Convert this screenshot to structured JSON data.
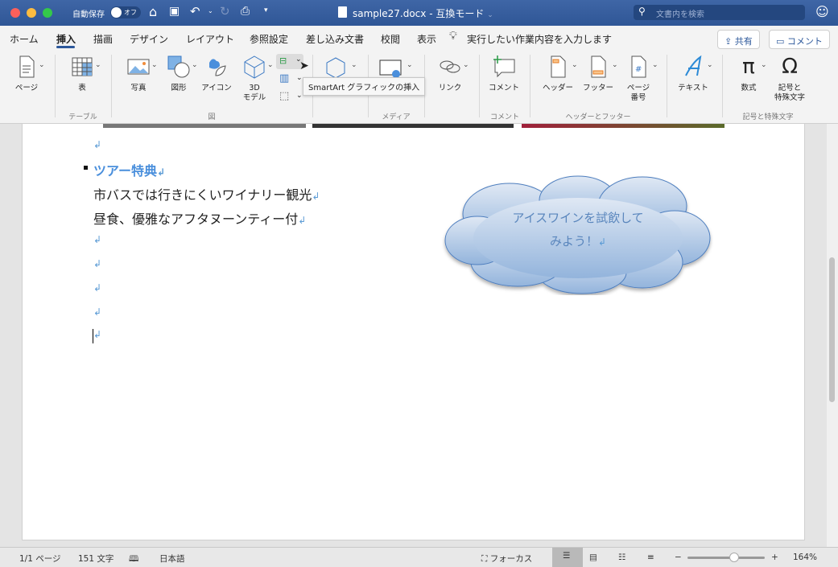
{
  "titlebar": {
    "autosave_label": "自動保存",
    "autosave_state": "オフ",
    "filename": "sample27.docx",
    "separator": "-",
    "mode": "互換モード",
    "search_placeholder": "文書内を検索"
  },
  "tabs": [
    "ホーム",
    "挿入",
    "描画",
    "デザイン",
    "レイアウト",
    "参照設定",
    "差し込み文書",
    "校閲",
    "表示"
  ],
  "active_tab": "挿入",
  "tell_me": "実行したい作業内容を入力します",
  "share_label": "共有",
  "comment_label": "コメント",
  "ribbon": {
    "page": "ページ",
    "table": "表",
    "picture": "写真",
    "shapes": "図形",
    "icons": "アイコン",
    "model3d_1": "3D",
    "model3d_2": "モデル",
    "link": "リンク",
    "comment": "コメント",
    "header": "ヘッダー",
    "footer": "フッター",
    "pagenum_1": "ページ",
    "pagenum_2": "番号",
    "text": "テキスト",
    "equation": "数式",
    "symbol_1": "記号と",
    "symbol_2": "特殊文字",
    "groups": {
      "table": "テーブル",
      "illustrations": "図",
      "media": "メディア",
      "comments": "コメント",
      "header_footer": "ヘッダーとフッター",
      "symbols": "記号と特殊文字"
    }
  },
  "tooltip": "SmartArt グラフィックの挿入",
  "document": {
    "heading": "ツアー特典",
    "lines": [
      "市バスでは行きにくいワイナリー観光",
      "昼食、優雅なアフタヌーンティー付"
    ],
    "callout": [
      "アイスワインを試飲して",
      "みよう！"
    ],
    "para_mark": "↲"
  },
  "status": {
    "page": "1/1 ページ",
    "words": "151 文字",
    "language": "日本語",
    "focus": "フォーカス",
    "zoom": "164%",
    "zoom_fraction": 0.6
  },
  "colors": {
    "title_bar": "#2f5696",
    "accent": "#2b579a",
    "heading": "#4a8fdc",
    "callout_fill": "#a9c3e3"
  }
}
